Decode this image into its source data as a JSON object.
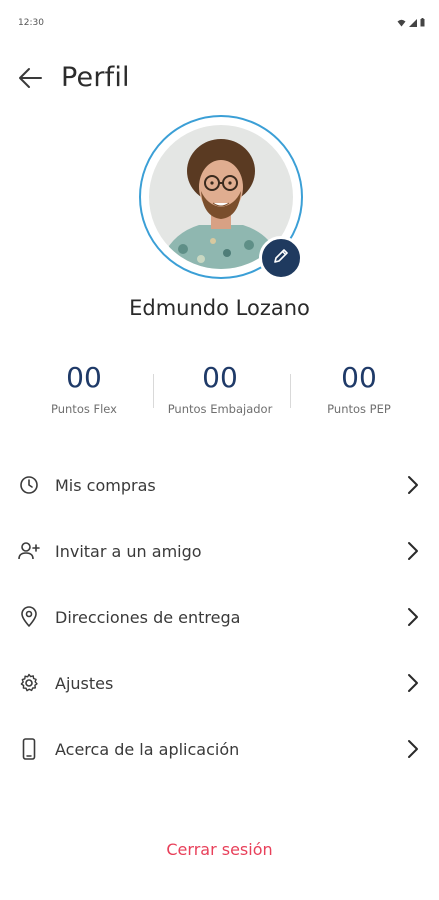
{
  "status_bar": {
    "time": "12:30",
    "icons": [
      "wifi-icon",
      "signal-icon",
      "battery-icon"
    ]
  },
  "header": {
    "title": "Perfil",
    "back_icon": "arrow-left-icon"
  },
  "profile": {
    "name": "Edmundo Lozano",
    "avatar": "user-avatar-photo",
    "edit_icon": "pencil-icon"
  },
  "stats": [
    {
      "value": "00",
      "label": "Puntos Flex"
    },
    {
      "value": "00",
      "label": "Puntos Embajador"
    },
    {
      "value": "00",
      "label": "Puntos PEP"
    }
  ],
  "menu": [
    {
      "label": "Mis compras",
      "icon": "clock-icon"
    },
    {
      "label": "Invitar a un amigo",
      "icon": "add-user-icon"
    },
    {
      "label": "Direcciones de entrega",
      "icon": "location-pin-icon"
    },
    {
      "label": "Ajustes",
      "icon": "gear-icon"
    },
    {
      "label": "Acerca de la aplicación",
      "icon": "smartphone-icon"
    }
  ],
  "logout_label": "Cerrar sesión",
  "colors": {
    "accent_ring": "#3b9fd6",
    "stat_value": "#1f3a68",
    "edit_badge": "#1f3a5f",
    "logout": "#e8405a"
  }
}
